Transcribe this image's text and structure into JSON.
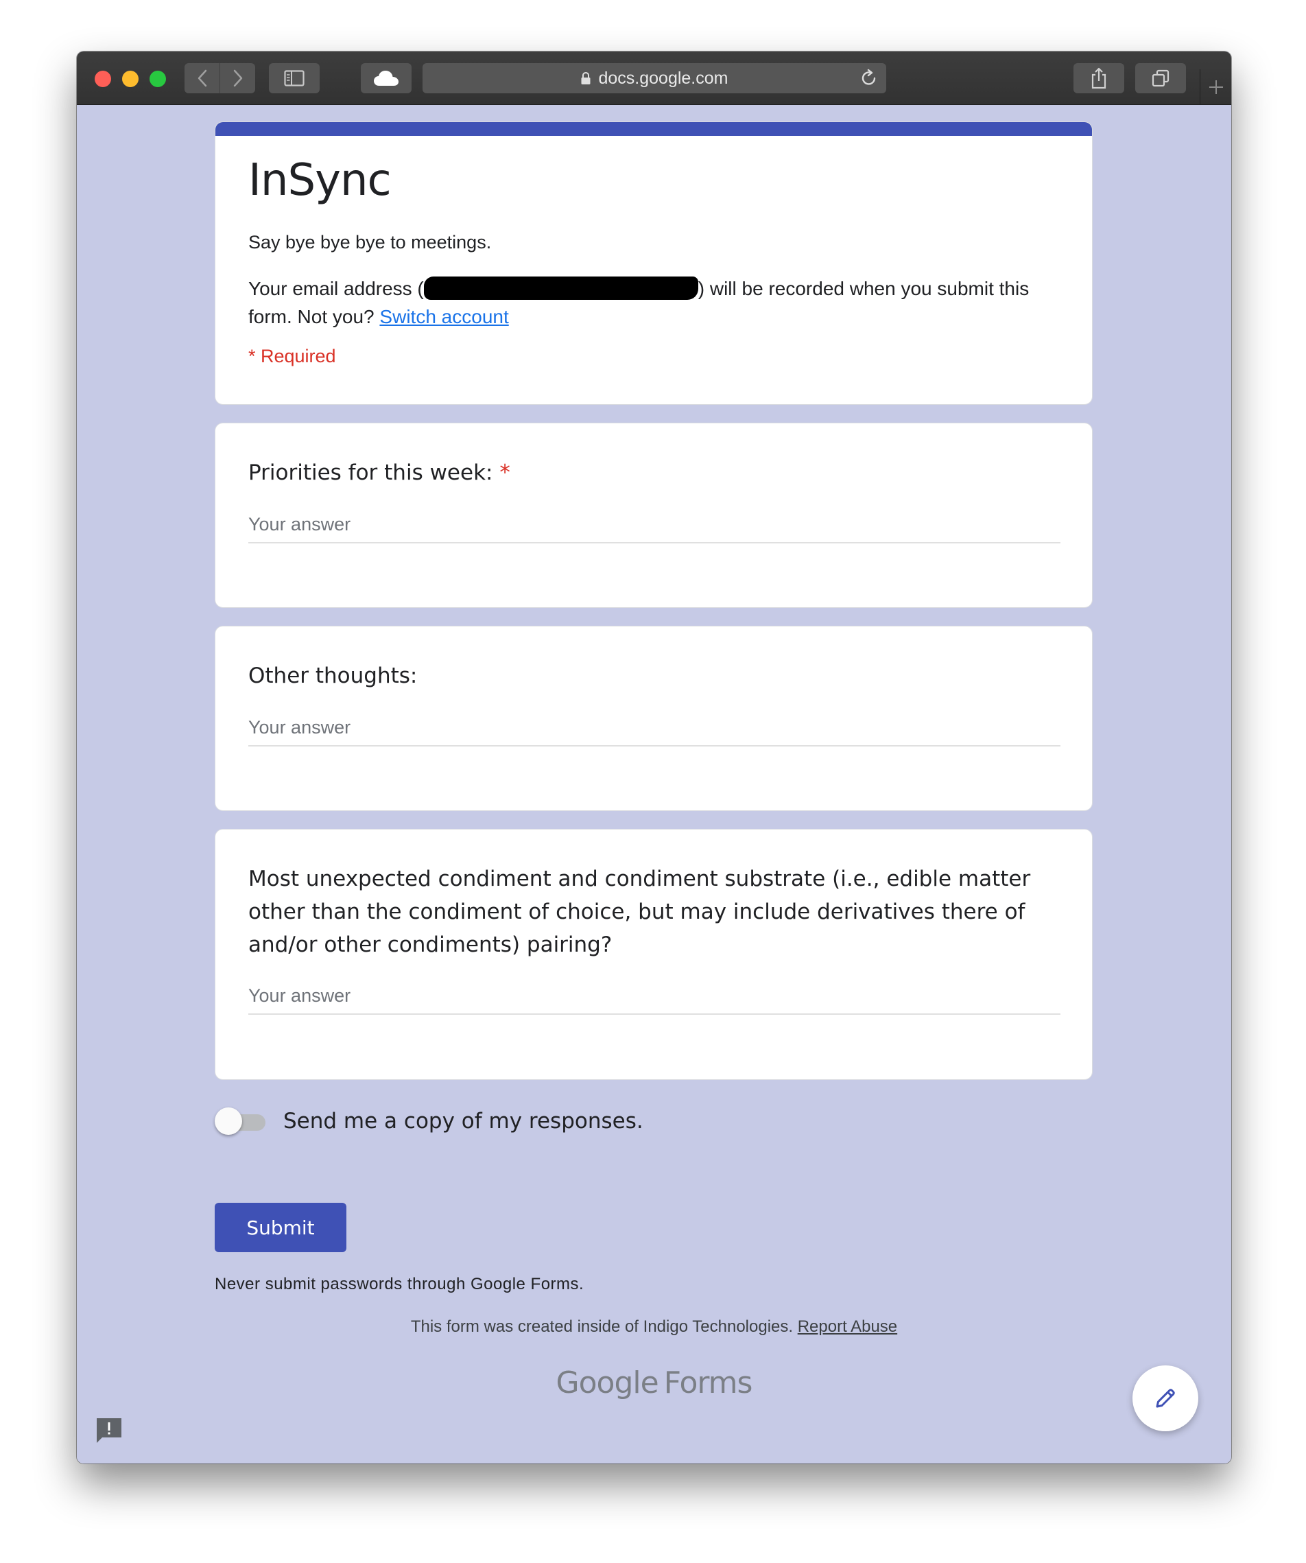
{
  "browser": {
    "url": "docs.google.com"
  },
  "form": {
    "title": "InSync",
    "description": "Say bye bye bye to meetings.",
    "email_notice_before": "Your email address (",
    "email_notice_after": ") will be recorded when you submit this form. Not you?",
    "switch_account": "Switch account",
    "required_note": "* Required",
    "accent_color": "#3f51b5"
  },
  "questions": [
    {
      "label": "Priorities for this week:",
      "required": true,
      "required_mark": "*",
      "placeholder": "Your answer",
      "value": ""
    },
    {
      "label": "Other thoughts:",
      "required": false,
      "placeholder": "Your answer",
      "value": ""
    },
    {
      "label": "Most unexpected condiment and condiment substrate (i.e., edible matter other than the condiment of choice, but may include derivatives there of and/or other condiments) pairing?",
      "required": false,
      "placeholder": "Your answer",
      "value": ""
    }
  ],
  "copy_toggle": {
    "label": "Send me a copy of my responses.",
    "on": false
  },
  "submit_label": "Submit",
  "password_warning": "Never submit passwords through Google Forms.",
  "footer": {
    "created_inside": "This form was created inside of Indigo Technologies.",
    "report_abuse": "Report Abuse",
    "brand_google": "Google",
    "brand_forms": "Forms"
  },
  "icons": {
    "edit": "pencil-icon",
    "feedback": "feedback-icon"
  }
}
